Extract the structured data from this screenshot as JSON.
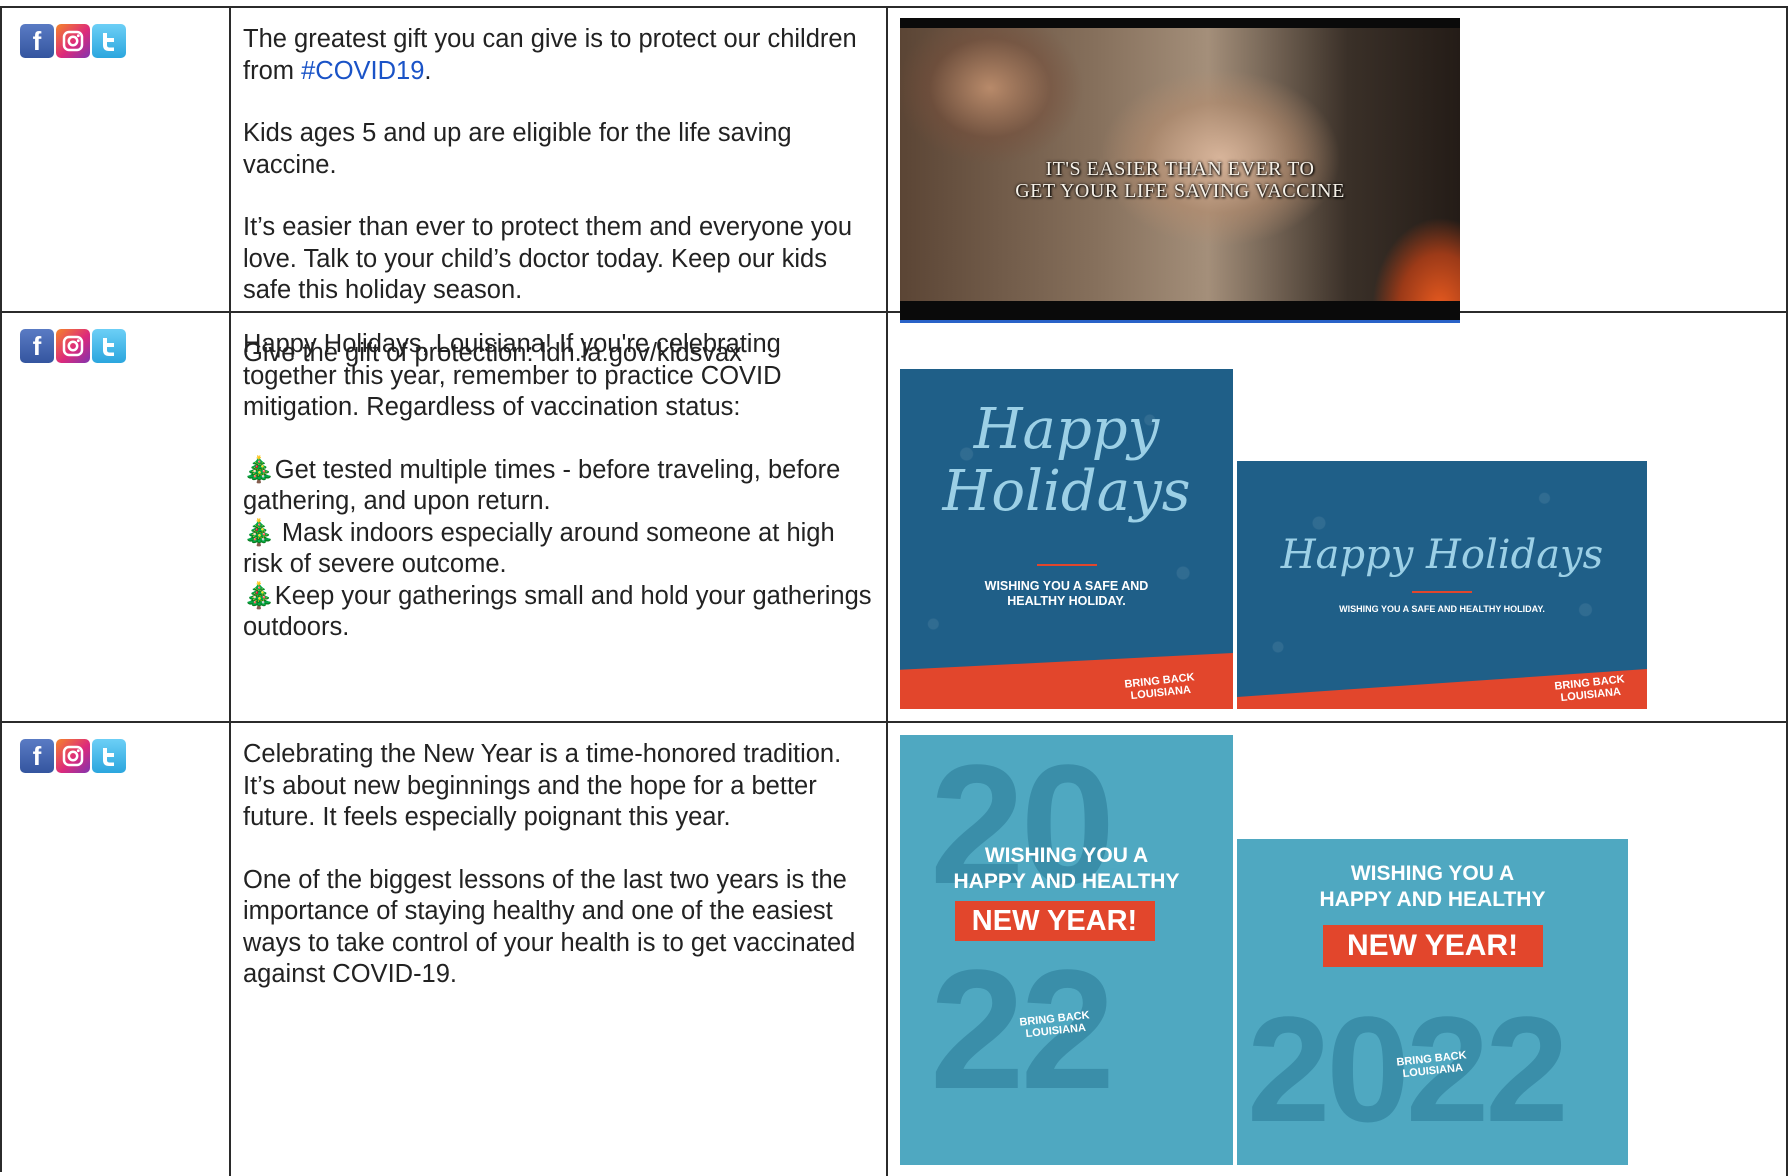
{
  "icons": {
    "facebook": "facebook-icon",
    "instagram": "instagram-icon",
    "twitter": "twitter-icon"
  },
  "colors": {
    "link": "#1a53c7",
    "card_blue": "#1f5f88",
    "card_teal": "#4fa8c1",
    "accent_red": "#e2462c"
  },
  "posts": [
    {
      "text_parts": {
        "p1_before": "The greatest gift you can give is to protect our children from ",
        "hashtag": "#COVID19",
        "p1_after": ".",
        "p2": "Kids ages 5 and up are eligible for the life saving vaccine.",
        "p3": "It’s easier than ever to protect them and everyone you love. Talk to your child’s doctor today. Keep our kids safe this holiday season.",
        "p4": "Give the gift of protection: ldh.la.gov/kidsvax"
      },
      "media": {
        "caption_line1": "IT'S EASIER THAN EVER TO",
        "caption_line2": "GET YOUR LIFE SAVING VACCINE"
      }
    },
    {
      "text_parts": {
        "intro": "Happy Holidays, Louisiana! If you're celebrating together this year, remember to practice COVID mitigation. Regardless of vaccination status:",
        "b1": "🎄Get tested multiple times - before traveling, before gathering, and upon return.",
        "b2": "🎄 Mask indoors especially around someone at high risk of severe outcome.",
        "b3": "🎄Keep your gatherings small and hold your gatherings outdoors."
      },
      "media": {
        "card1_script": "Happy Holidays",
        "card1_wish": "WISHING YOU A SAFE AND HEALTHY HOLIDAY.",
        "card2_script": "Happy Holidays",
        "card2_wish": "WISHING YOU A SAFE AND HEALTHY HOLIDAY.",
        "brand_line1": "BRING BACK",
        "brand_line2": "LOUISIANA"
      }
    },
    {
      "text_parts": {
        "p1": "Celebrating the New Year is a time-honored tradition. It’s about new beginnings and the hope for a better future. It feels especially poignant this year.",
        "p2": "One of the biggest lessons of the last two years is the importance of staying healthy and one of the easiest ways to take control of your health is to get vaccinated against COVID-19."
      },
      "media": {
        "year_top": "20",
        "year_bottom": "22",
        "year_full": "2022",
        "wish_line1": "WISHING YOU A",
        "wish_line2": "HAPPY AND HEALTHY",
        "new_year": "NEW YEAR!",
        "brand_line1": "BRING BACK",
        "brand_line2": "LOUISIANA"
      }
    }
  ]
}
